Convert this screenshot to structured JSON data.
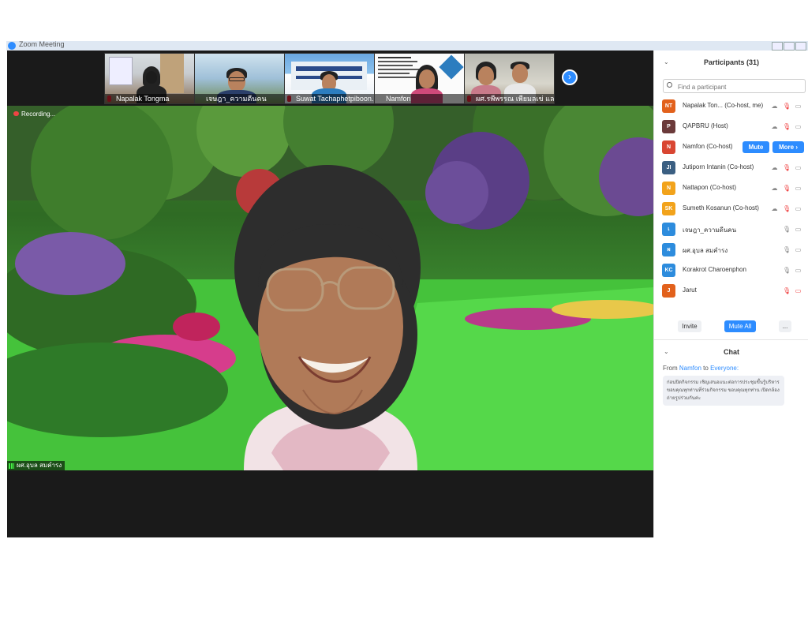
{
  "window": {
    "title": "Zoom Meeting"
  },
  "thumbnails": [
    {
      "name": "Napalak Tongma"
    },
    {
      "name": "เจษฎา_ความดีนคน"
    },
    {
      "name": "Suwat Tachaphetpiboon..."
    },
    {
      "name": "Namfon"
    },
    {
      "name": "ผศ.รพีพรรณ เพียมลเข่ แล..."
    }
  ],
  "main_video": {
    "recording_label": "Recording...",
    "speaker_name": "ผศ.อุบล สมคำรง"
  },
  "participants": {
    "header": "Participants (31)",
    "search_placeholder": "Find a participant",
    "list": [
      {
        "initials": "NT",
        "color": "#e2611c",
        "name": "Napalak Ton... (Co-host, me)",
        "mic": "muted",
        "video": "off"
      },
      {
        "initials": "P",
        "color": "#6b3a3a",
        "name": "QAPBRU (Host)",
        "mic": "muted",
        "video": "off"
      },
      {
        "initials": "N",
        "color": "#d94632",
        "name": "Namfon (Co-host)",
        "mute_label": "Mute",
        "more_label": "More ›"
      },
      {
        "initials": "JI",
        "color": "#3b5f82",
        "name": "Jutiporn Intanin (Co-host)",
        "mic": "muted",
        "video": "off"
      },
      {
        "initials": "N",
        "color": "#f2a31b",
        "name": "Nattapon (Co-host)",
        "mic": "muted",
        "video": "off"
      },
      {
        "initials": "SK",
        "color": "#f2a31b",
        "name": "Sumeth Kosanun (Co-host)",
        "mic": "muted",
        "video": "off"
      },
      {
        "initials": "เ",
        "color": "#2d8cdd",
        "name": "เจษฎา_ความดีนคน",
        "mic": "on",
        "video": "off"
      },
      {
        "initials": "ผ",
        "color": "#2d8cdd",
        "name": "ผศ.อุบล สมคำรง",
        "mic": "on",
        "video": "off"
      },
      {
        "initials": "KC",
        "color": "#2d8cdd",
        "name": "Korakrot Charoenphon",
        "mic": "on",
        "video": "off"
      },
      {
        "initials": "J",
        "color": "#e2611c",
        "name": "Jarut",
        "mic": "muted",
        "video": "muted"
      }
    ],
    "invite_label": "Invite",
    "mute_all_label": "Mute All",
    "more_label": "..."
  },
  "chat": {
    "header": "Chat",
    "from_prefix": "From",
    "from": "Namfon",
    "to_word": "to",
    "to": "Everyone:",
    "message": "ก่อนปิดกิจกรรม เชิญเสนอแนะต่อการประชุมขึ้นรู้บริหาร ขอบคุณทุกท่านที่ร่วมกิจกรรม ขอบคุณทุกท่าน เปิดกล้อง ถ่ายรูปร่วมกันค่ะ"
  }
}
